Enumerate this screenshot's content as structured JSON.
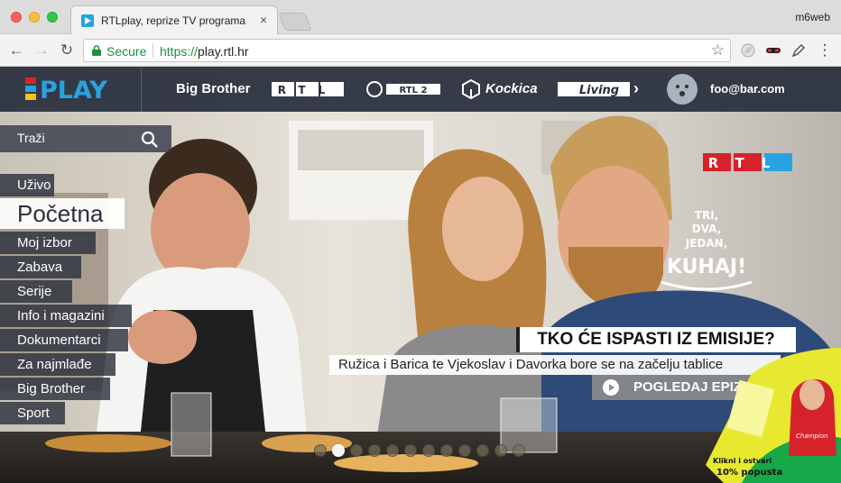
{
  "browser": {
    "tab_title": "RTLplay, reprize TV programa",
    "tab_close": "×",
    "profile_name": "m6web",
    "secure_label": "Secure",
    "url_protocol": "https://",
    "url_host": "play.rtl.hr",
    "back": "←",
    "forward": "→",
    "reload": "↻",
    "bookmark": "☆",
    "menu": "⋮"
  },
  "site": {
    "logo": "PLAY",
    "logo_prefix": "RTL",
    "channels": [
      "Big Brother",
      "RTL",
      "RTL 2",
      "Kockica",
      "Living"
    ],
    "next_arrow": "›",
    "user_email": "foo@bar.com"
  },
  "search": {
    "label": "Traži"
  },
  "menu": {
    "items": [
      {
        "label": "Uživo"
      },
      {
        "label": "Početna",
        "active": true
      },
      {
        "label": "Moj izbor"
      },
      {
        "label": "Zabava"
      },
      {
        "label": "Serije"
      },
      {
        "label": "Info i magazini"
      },
      {
        "label": "Dokumentarci"
      },
      {
        "label": "Za najmlađe"
      },
      {
        "label": "Big Brother"
      },
      {
        "label": "Sport"
      }
    ]
  },
  "hero": {
    "badge": "RTL",
    "show_logo": [
      "TRI,",
      "DVA,",
      "JEDAN,",
      "KUHAJ!"
    ],
    "headline": "TKO ĆE ISPASTI IZ EMISIJE?",
    "subline": "Ružica i Barica te Vjekoslav i Davorka bore se na začelju tablice",
    "cta": "POGLEDAJ EPIZODU",
    "slides_total": 12,
    "slide_active": 2
  },
  "ad": {
    "brand": "Champion",
    "text_small": "Klikni i ostvari",
    "text_discount": "10% popusta"
  },
  "colors": {
    "nav_bg": "#282e3c",
    "rtl_red": "#d6232b",
    "play_blue": "#27a3e1",
    "ad_yellow": "#e8e830",
    "ad_green": "#18a84a"
  }
}
